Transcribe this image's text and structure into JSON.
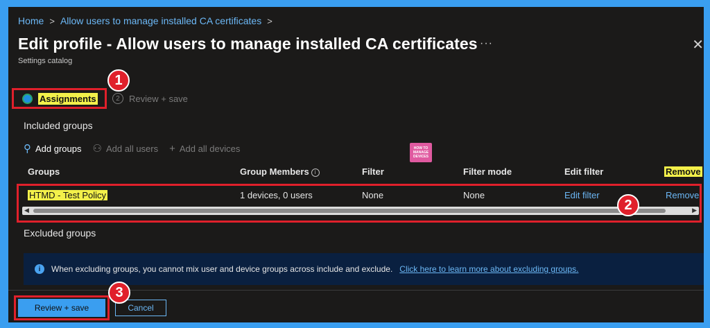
{
  "breadcrumb": {
    "home": "Home",
    "current": "Allow users to manage installed CA certificates",
    "separator": ">"
  },
  "header": {
    "title": "Edit profile - Allow users to manage installed CA certificates",
    "subtitle": "Settings catalog",
    "more": "···",
    "close": "✕"
  },
  "steps": [
    {
      "label": "Assignments",
      "state": "active"
    },
    {
      "number": "2",
      "label": "Review + save",
      "state": "inactive"
    }
  ],
  "annotations": [
    "1",
    "2",
    "3"
  ],
  "included": {
    "heading": "Included groups",
    "actions": [
      {
        "label": "Add groups",
        "icon": "add-user-icon",
        "enabled": true
      },
      {
        "label": "Add all users",
        "icon": "users-icon",
        "enabled": false
      },
      {
        "label": "Add all devices",
        "icon": "plus-icon",
        "enabled": false
      }
    ],
    "columns": [
      "Groups",
      "Group Members",
      "Filter",
      "Filter mode",
      "Edit filter",
      "Remove"
    ],
    "rows": [
      {
        "group": "HTMD - Test Policy",
        "members": "1 devices, 0 users",
        "filter": "None",
        "filter_mode": "None",
        "edit_filter": "Edit filter",
        "remove": "Remove"
      }
    ]
  },
  "logo": {
    "line1": "HOW TO",
    "line2": "MANAGE",
    "line3": "DEVICES"
  },
  "excluded": {
    "heading": "Excluded groups",
    "info_text": "When excluding groups, you cannot mix user and device groups across include and exclude.",
    "info_link": "Click here to learn more about excluding groups."
  },
  "footer": {
    "review_label": "Review + save",
    "cancel_label": "Cancel"
  },
  "colors": {
    "accent": "#3a9ef0",
    "highlight": "#f3f04a",
    "annotation": "#e0202b",
    "background": "#1b1a19"
  }
}
